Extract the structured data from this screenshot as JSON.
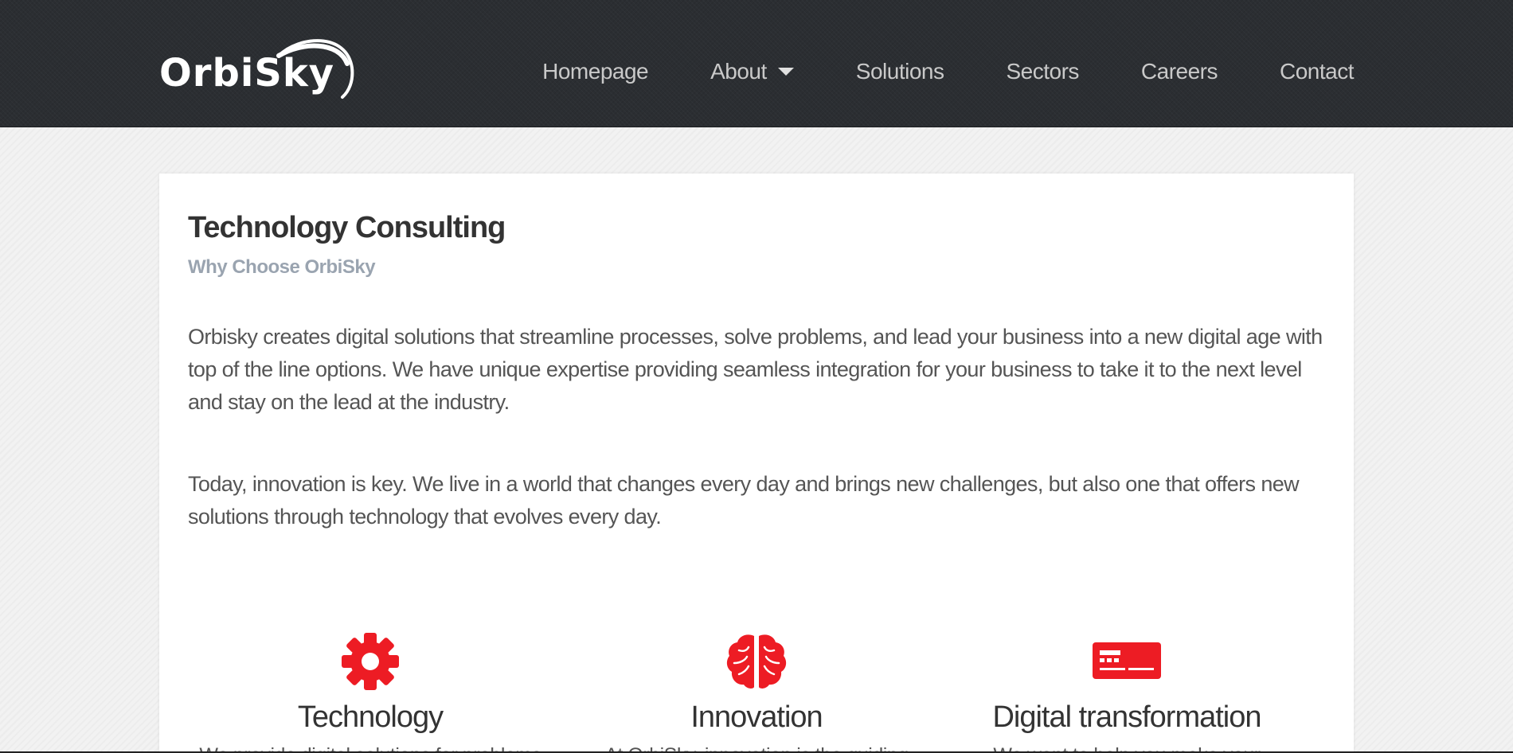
{
  "brand": {
    "logo_text": "OrbiSky",
    "accent_color": "#ed1c24",
    "header_bg": "#2b2e32"
  },
  "nav": {
    "items": [
      {
        "label": "Homepage",
        "has_dropdown": false
      },
      {
        "label": "About",
        "has_dropdown": true
      },
      {
        "label": "Solutions",
        "has_dropdown": false
      },
      {
        "label": "Sectors",
        "has_dropdown": false
      },
      {
        "label": "Careers",
        "has_dropdown": false
      },
      {
        "label": "Contact",
        "has_dropdown": false
      }
    ]
  },
  "main": {
    "title": "Technology Consulting",
    "subtitle": "Why Choose OrbiSky",
    "paragraphs": [
      "Orbisky creates digital solutions that streamline processes, solve problems, and lead your business into a new digital age with top of the line options. We have unique expertise providing seamless integration for your business to take it to the next level and stay on the lead at the industry.",
      "Today, innovation is key. We live in a world that changes every day and brings new challenges, but also one that offers new solutions through technology that evolves every day."
    ],
    "features": [
      {
        "icon": "gear-icon",
        "title": "Technology",
        "description": "We provide digital solutions for problems"
      },
      {
        "icon": "brain-icon",
        "title": "Innovation",
        "description": "At OrbiSky, innovation is the guiding"
      },
      {
        "icon": "card-icon",
        "title": "Digital transformation",
        "description": "We want to help you make your"
      }
    ]
  }
}
